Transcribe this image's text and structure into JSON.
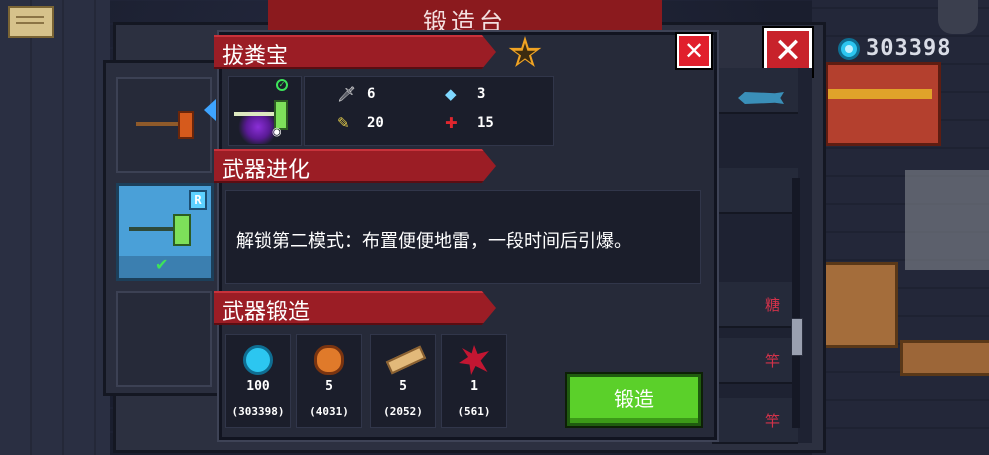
{
  "forge_window": {
    "title": "锻造台",
    "gems_total": "303398",
    "list_items": [
      "",
      "",
      "糖",
      "竿",
      "竿"
    ]
  },
  "weapon": {
    "name": "拔粪宝",
    "rarity_badge": "R",
    "stats": {
      "damage": "6",
      "energy": "3",
      "crit": "20",
      "accuracy": "15"
    }
  },
  "evolution": {
    "heading": "武器进化",
    "description": "解锁第二模式：布置便便地雷，一段时间后引爆。"
  },
  "forging": {
    "heading": "武器锻造",
    "materials": [
      {
        "icon": "gem-icon",
        "required": "100",
        "owned": "(303398)"
      },
      {
        "icon": "ore-icon",
        "required": "5",
        "owned": "(4031)"
      },
      {
        "icon": "wood-plank-icon",
        "required": "5",
        "owned": "(2052)"
      },
      {
        "icon": "red-leaf-icon",
        "required": "1",
        "owned": "(561)"
      }
    ],
    "button_label": "锻造"
  },
  "colors": {
    "ribbon": "#9b1d25",
    "forge_button": "#5bd02a",
    "close_button": "#e11f2c",
    "gem": "#2cc6f0"
  }
}
